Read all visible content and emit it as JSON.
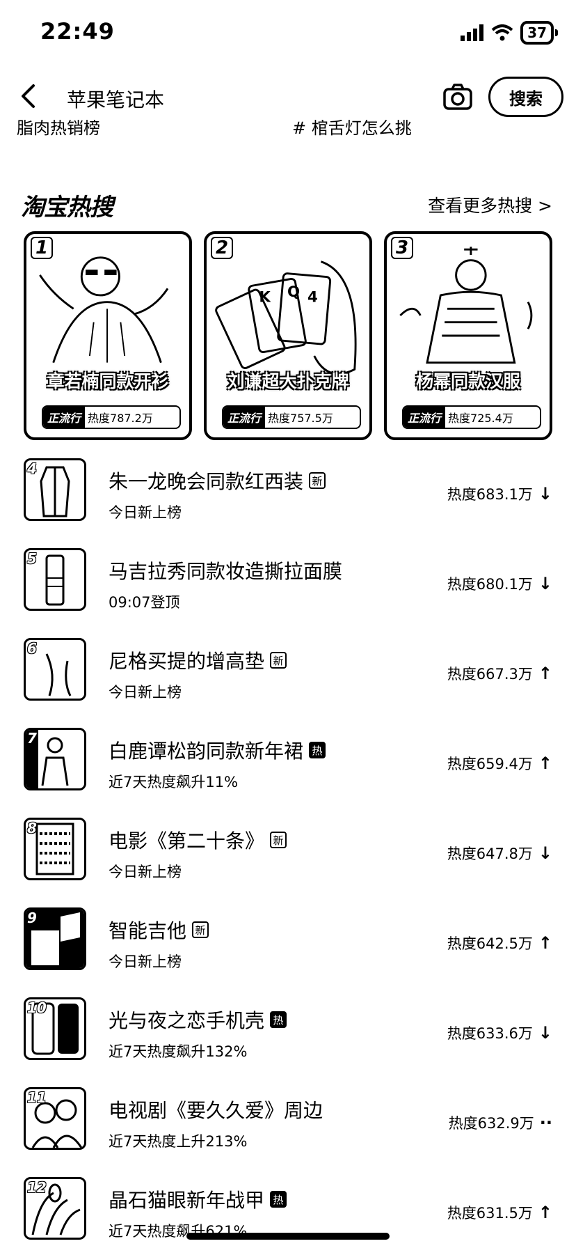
{
  "status_bar": {
    "time": "22:49",
    "battery": "37"
  },
  "header": {
    "back_icon": "chevron-left-icon",
    "title": "苹果笔记本",
    "camera_icon": "camera-icon",
    "search_label": "搜索"
  },
  "suggestions": [
    "脂肉热销榜",
    "# 棺舌灯怎么挑"
  ],
  "section": {
    "title": "淘宝热搜",
    "more_label": "查看更多热搜 >"
  },
  "top_cards": [
    {
      "rank": "1",
      "name": "章若楠同款开衫",
      "tag": "正流行",
      "heat": "热度787.2万"
    },
    {
      "rank": "2",
      "name": "刘谦超大扑克牌",
      "tag": "正流行",
      "heat": "热度757.5万"
    },
    {
      "rank": "3",
      "name": "杨幂同款汉服",
      "tag": "正流行",
      "heat": "热度725.4万"
    }
  ],
  "list": [
    {
      "rank": "4",
      "title": "朱一龙晚会同款红西装",
      "tag": "新",
      "sub": "今日新上榜",
      "heat": "热度683.1万",
      "trend": "↓"
    },
    {
      "rank": "5",
      "title": "马吉拉秀同款妆造撕拉面膜",
      "tag": "",
      "sub": "09:07登顶",
      "heat": "热度680.1万",
      "trend": "↓"
    },
    {
      "rank": "6",
      "title": "尼格买提的增高垫",
      "tag": "新",
      "sub": "今日新上榜",
      "heat": "热度667.3万",
      "trend": "↑"
    },
    {
      "rank": "7",
      "title": "白鹿谭松韵同款新年裙",
      "tag": "热",
      "sub": "近7天热度飙升11%",
      "heat": "热度659.4万",
      "trend": "↑"
    },
    {
      "rank": "8",
      "title": "电影《第二十条》",
      "tag": "新",
      "sub": "今日新上榜",
      "heat": "热度647.8万",
      "trend": "↓"
    },
    {
      "rank": "9",
      "title": "智能吉他",
      "tag": "新",
      "sub": "今日新上榜",
      "heat": "热度642.5万",
      "trend": "↑"
    },
    {
      "rank": "10",
      "title": "光与夜之恋手机壳",
      "tag": "热",
      "sub": "近7天热度飙升132%",
      "heat": "热度633.6万",
      "trend": "↓"
    },
    {
      "rank": "11",
      "title": "电视剧《要久久爱》周边",
      "tag": "",
      "sub": "近7天热度上升213%",
      "heat": "热度632.9万",
      "trend": "··"
    },
    {
      "rank": "12",
      "title": "晶石猫眼新年战甲",
      "tag": "热",
      "sub": "近7天热度飙升621%",
      "heat": "热度631.5万",
      "trend": "↑"
    }
  ]
}
